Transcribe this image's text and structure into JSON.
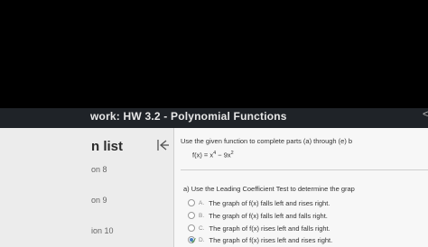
{
  "header": {
    "title": "work: HW 3.2 - Polynomial Functions",
    "chevron": "<"
  },
  "sidebar": {
    "title": "n list",
    "items": [
      {
        "label": "on 8"
      },
      {
        "label": "on 9"
      },
      {
        "label": "ion 10"
      }
    ]
  },
  "question": {
    "instruction": "Use the given function to complete parts (a) through (e) b",
    "function_prefix": "f(x) = x",
    "function_exp1": "4",
    "function_mid": " − 9x",
    "function_exp2": "2",
    "part_a_prompt": "a) Use the Leading Coefficient Test to determine the grap",
    "choices": [
      {
        "letter": "A.",
        "text": "The graph of f(x) falls left and rises right."
      },
      {
        "letter": "B.",
        "text": "The graph of f(x) falls left and falls right."
      },
      {
        "letter": "C.",
        "text": "The graph of f(x) rises left and falls right."
      },
      {
        "letter": "D.",
        "text": "The graph of f(x) rises left and rises right."
      }
    ],
    "selected_choice": "D"
  },
  "colors": {
    "header_bg": "#1f2328",
    "selected_radio": "#4a7fc1",
    "correct_check": "#3a8f3a"
  }
}
